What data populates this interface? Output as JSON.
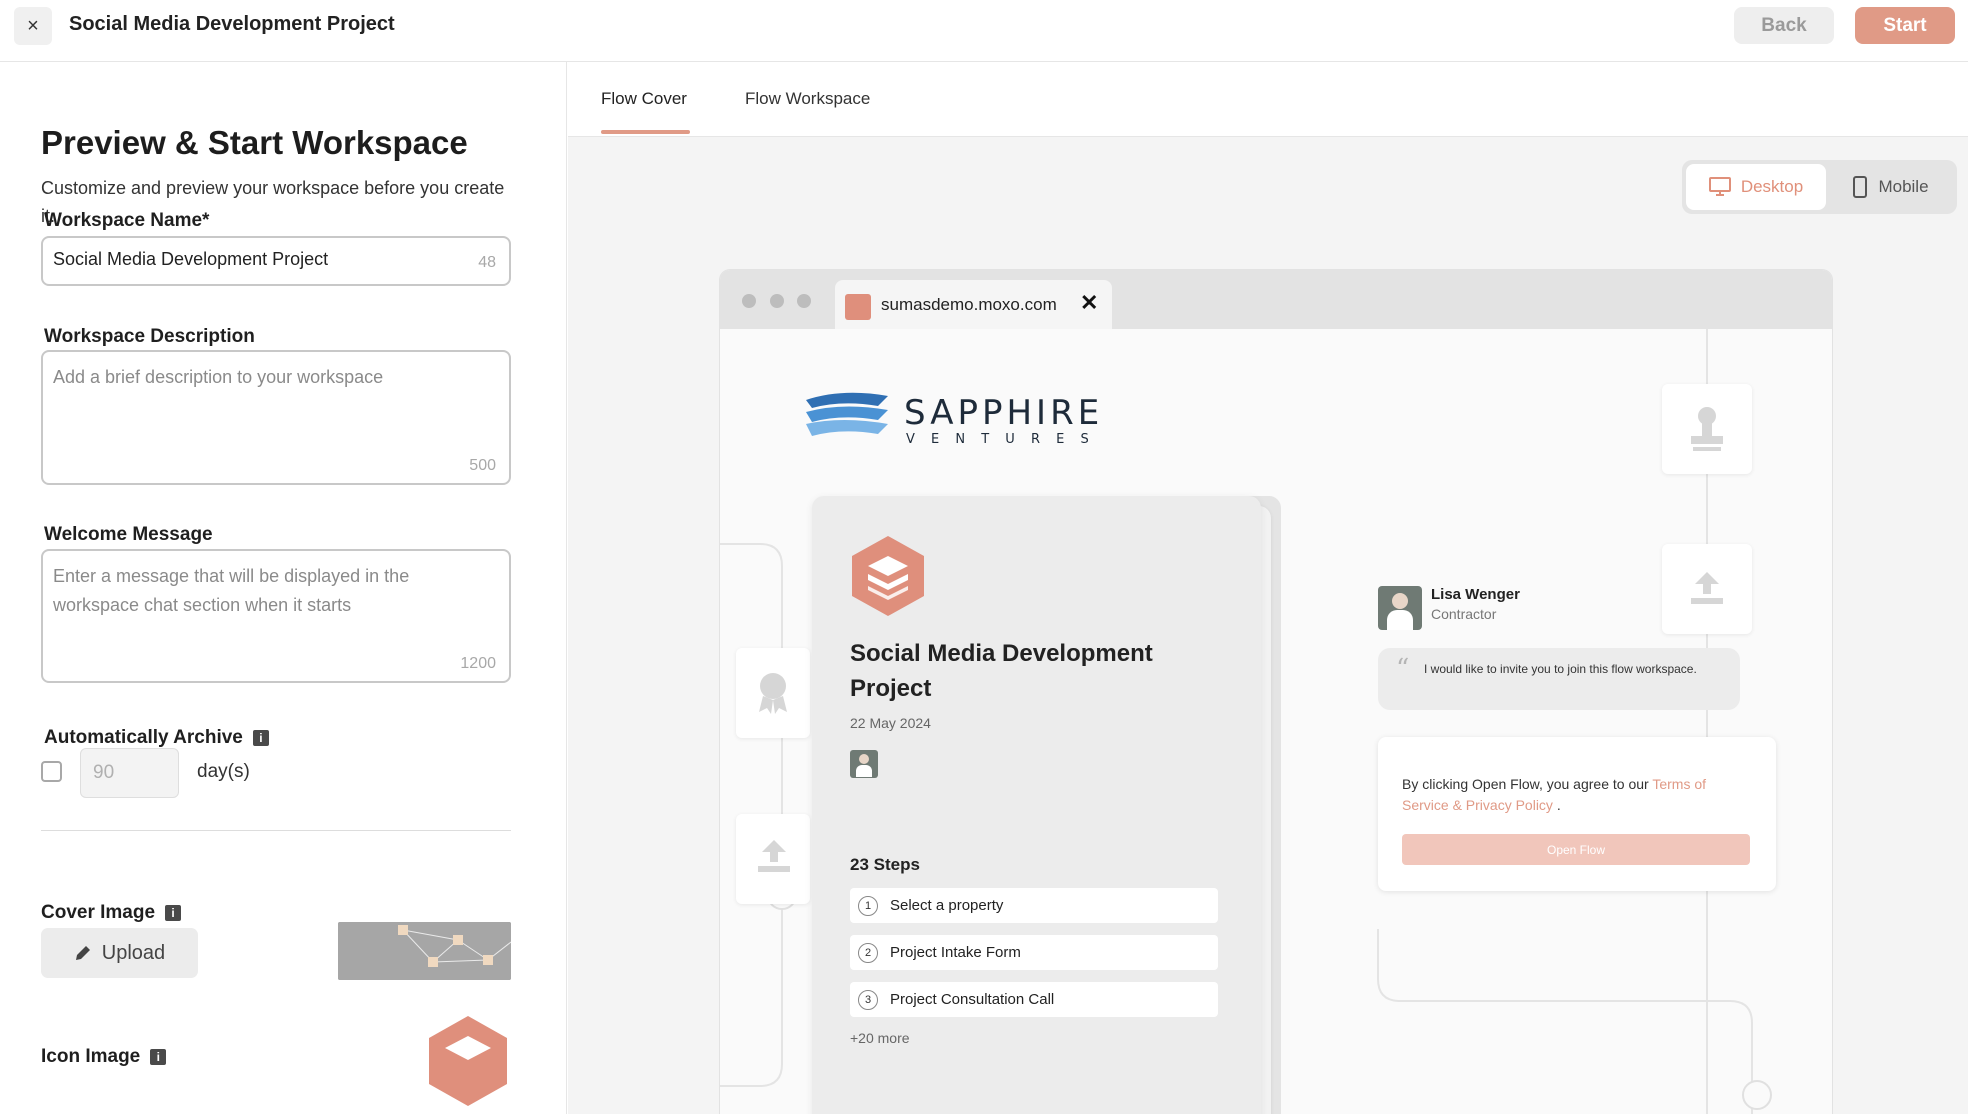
{
  "topbar": {
    "close_glyph": "×",
    "title": "Social Media Development Project",
    "back_label": "Back",
    "start_label": "Start"
  },
  "left": {
    "title": "Preview & Start Workspace",
    "subtitle": "Customize and preview your workspace before you create it.",
    "workspace_name": {
      "label": "Workspace Name*",
      "value": "Social Media Development Project",
      "count": "48"
    },
    "workspace_description": {
      "label": "Workspace Description",
      "placeholder": "Add a brief description to your workspace",
      "count": "500"
    },
    "welcome_message": {
      "label": "Welcome Message",
      "placeholder": "Enter a message that will be displayed in the workspace chat section when it starts",
      "count": "1200"
    },
    "auto_archive": {
      "label": "Automatically Archive",
      "days_value": "90",
      "days_label": "day(s)",
      "checked": false
    },
    "cover_image": {
      "label": "Cover Image",
      "upload_label": "Upload"
    },
    "icon_image": {
      "label": "Icon Image"
    },
    "info_glyph": "i"
  },
  "tabs": [
    {
      "label": "Flow Cover",
      "active": true
    },
    {
      "label": "Flow Workspace",
      "active": false
    }
  ],
  "device_toggle": {
    "desktop_label": "Desktop",
    "mobile_label": "Mobile",
    "selected": "Desktop"
  },
  "preview": {
    "url": "sumasdemo.moxo.com",
    "tab_close_glyph": "✕",
    "brand": {
      "name": "SAPPHIRE",
      "tagline": "V E N T U R E S"
    },
    "flow": {
      "title": "Social Media Development Project",
      "date": "22 May 2024",
      "steps_title": "23 Steps",
      "steps": [
        {
          "num": "1",
          "label": "Select a property"
        },
        {
          "num": "2",
          "label": "Project Intake Form"
        },
        {
          "num": "3",
          "label": "Project Consultation Call"
        }
      ],
      "more": "+20 more"
    },
    "invite": {
      "name": "Lisa Wenger",
      "role": "Contractor",
      "quote_mark": "“",
      "message": "I would like to invite you to join this flow workspace."
    },
    "agree": {
      "text": "By clicking Open Flow, you agree to our ",
      "link": "Terms of Service & Privacy Policy",
      "suffix": " .",
      "button": "Open Flow"
    }
  },
  "colors": {
    "accent": "#e09a86",
    "accent_light": "#f1c6bb",
    "canvas": "#f4f4f4"
  }
}
